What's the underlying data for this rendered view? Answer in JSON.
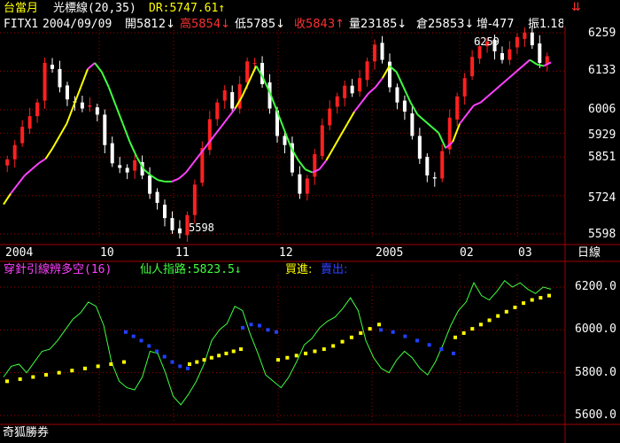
{
  "header": {
    "title": "台當月",
    "indicator": "光標線(20,35)",
    "dr": "DR:5747.61↑",
    "symbol": "FITX1",
    "date": "2004/09/09",
    "open": "開5812↓",
    "high": "高5854↓",
    "low": "低5785↓",
    "close": "收5843↑",
    "volume": "量23185↓",
    "oi": "倉25853↓",
    "change": "增-477",
    "amp": "振1.18"
  },
  "price_panel": {
    "y_ticks": [
      "6259",
      "6133",
      "6006",
      "5929",
      "5851",
      "5724",
      "5598"
    ],
    "annot_high": "6259",
    "annot_low": "5598"
  },
  "x_axis": {
    "labels": [
      "2004",
      "10",
      "11",
      "12",
      "2005",
      "02",
      "03"
    ],
    "period": "日線"
  },
  "indicator_panel": {
    "name": "穿針引線辨多空(16)",
    "line_label": "仙人指路:5823.5↓",
    "buy_label": "買進:",
    "sell_label": "賣出:",
    "y_ticks": [
      "6200.0",
      "6000.0",
      "5800.0",
      "5600.0"
    ]
  },
  "watermark": "奇狐勝券",
  "colors": {
    "up_candle": "#ff2020",
    "down_candle": "#ffffff",
    "line_green": "#40ff40",
    "line_magenta": "#ff40ff",
    "line_yellow": "#ffff00",
    "buy_dots": "#ffff00",
    "sell_dots": "#2040ff",
    "grid": "#a00000",
    "title": "#ffff00",
    "indicator_name": "#ff40ff"
  },
  "chart_data": [
    {
      "type": "candlestick",
      "title": "FITX1 台當月 日線",
      "x": [
        "2004/09",
        "2004/10",
        "2004/11",
        "2004/12",
        "2005/01",
        "2005/02",
        "2005/03"
      ],
      "y_ticks": [
        5598,
        5724,
        5851,
        5929,
        6006,
        6133,
        6259
      ],
      "ylim": [
        5598,
        6259
      ],
      "closes": [
        5843,
        5890,
        5950,
        5985,
        6030,
        6160,
        6140,
        6080,
        6040,
        6030,
        6010,
        6020,
        5990,
        5890,
        5830,
        5815,
        5800,
        5840,
        5790,
        5730,
        5700,
        5650,
        5610,
        5600,
        5660,
        5760,
        5880,
        5975,
        6030,
        6070,
        6010,
        6090,
        6165,
        6160,
        6090,
        6010,
        5920,
        5890,
        5800,
        5730,
        5780,
        5860,
        5955,
        6010,
        6050,
        6085,
        6060,
        6110,
        6165,
        6220,
        6170,
        6080,
        6030,
        6000,
        5920,
        5845,
        5790,
        5780,
        5870,
        5980,
        6050,
        6110,
        6180,
        6215,
        6230,
        6198,
        6170,
        6205,
        6245,
        6260,
        6218,
        6160,
        6182
      ],
      "series": [
        {
          "name": "光標線",
          "values": [
            5695,
            5730,
            5760,
            5790,
            5810,
            5830,
            5845,
            5880,
            5920,
            5960,
            6020,
            6080,
            6140,
            6160,
            6130,
            6080,
            6020,
            5960,
            5900,
            5850,
            5810,
            5790,
            5775,
            5770,
            5770,
            5780,
            5800,
            5830,
            5860,
            5890,
            5920,
            5950,
            5980,
            6010,
            6050,
            6100,
            6150,
            6110,
            6060,
            6000,
            5940,
            5880,
            5840,
            5810,
            5800,
            5810,
            5840,
            5880,
            5920,
            5960,
            6000,
            6030,
            6060,
            6080,
            6110,
            6150,
            6130,
            6080,
            6030,
            5990,
            5970,
            5950,
            5930,
            5880,
            5900,
            5960,
            5990,
            6020,
            6030,
            6050,
            6070,
            6090,
            6110,
            6130,
            6150,
            6170,
            6155,
            6150,
            6162
          ]
        }
      ]
    },
    {
      "type": "line",
      "title": "穿針引線辨多空(16)",
      "y_ticks": [
        5600,
        5800,
        6000,
        6200
      ],
      "ylim": [
        5560,
        6280
      ],
      "series": [
        {
          "name": "仙人指路",
          "values": [
            5780,
            5830,
            5840,
            5800,
            5850,
            5900,
            5910,
            5950,
            6000,
            6050,
            6080,
            6130,
            6110,
            6020,
            5850,
            5760,
            5730,
            5720,
            5780,
            5900,
            5890,
            5800,
            5690,
            5650,
            5700,
            5760,
            5840,
            5950,
            6000,
            6030,
            6110,
            6090,
            5980,
            5890,
            5790,
            5760,
            5730,
            5780,
            5850,
            5930,
            5960,
            6010,
            6040,
            6060,
            6100,
            6150,
            6090,
            5950,
            5870,
            5820,
            5800,
            5860,
            5900,
            5870,
            5820,
            5790,
            5850,
            5930,
            6020,
            6090,
            6130,
            6220,
            6160,
            6140,
            6180,
            6230,
            6200,
            6220,
            6190,
            6170,
            6200,
            6190
          ]
        },
        {
          "name": "買進",
          "values": [
            5760,
            5770,
            5780,
            5790,
            5800,
            5810,
            5820,
            5830,
            5840,
            5850,
            5860,
            5870,
            5880,
            5890,
            5900,
            5910,
            5925,
            5945,
            5965,
            5985,
            6005,
            6025,
            6045,
            6065,
            6085,
            6105,
            6125,
            6140,
            6150,
            6160
          ]
        },
        {
          "name": "賣出",
          "values": [
            5990,
            5970,
            5950,
            5925,
            5900,
            5875,
            5850,
            5830,
            5820,
            5890,
            5970,
            6010,
            6025,
            6020,
            6000,
            5990,
            5970,
            5950,
            5930,
            5910,
            5890
          ]
        }
      ]
    }
  ]
}
